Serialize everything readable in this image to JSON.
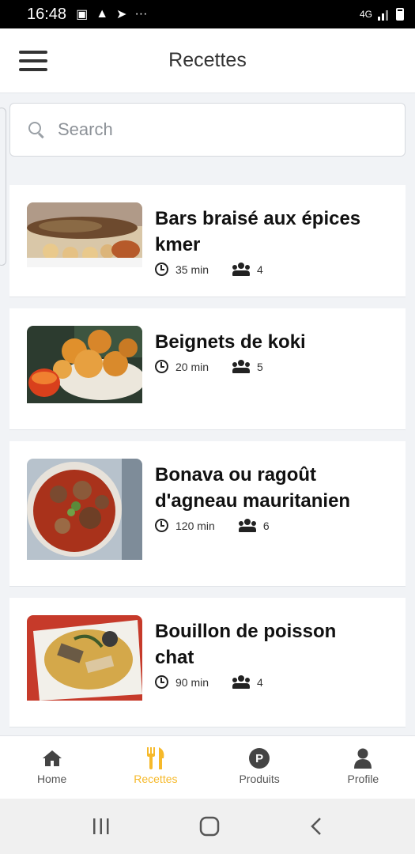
{
  "status_bar": {
    "time": "16:48",
    "network": "4G"
  },
  "app_bar": {
    "title": "Recettes",
    "menu_icon": "hamburger-icon"
  },
  "search": {
    "placeholder": "Search",
    "value": ""
  },
  "recipes": [
    {
      "name": "Bars braisé aux épices kmer",
      "time": "35 min",
      "servings": "4"
    },
    {
      "name": "Beignets de koki",
      "time": "20 min",
      "servings": "5"
    },
    {
      "name": "Bonava ou ragoût d'agneau mauritanien",
      "time": "120 min",
      "servings": "6"
    },
    {
      "name": "Bouillon de poisson chat",
      "time": "90 min",
      "servings": "4"
    }
  ],
  "bottom_nav": {
    "items": [
      {
        "label": "Home",
        "icon": "home-icon"
      },
      {
        "label": "Recettes",
        "icon": "fork-knife-icon",
        "active": true
      },
      {
        "label": "Produits",
        "icon": "p-badge-icon"
      },
      {
        "label": "Profile",
        "icon": "user-icon"
      }
    ]
  },
  "colors": {
    "accent": "#f6b92a",
    "background": "#f1f3f6"
  }
}
